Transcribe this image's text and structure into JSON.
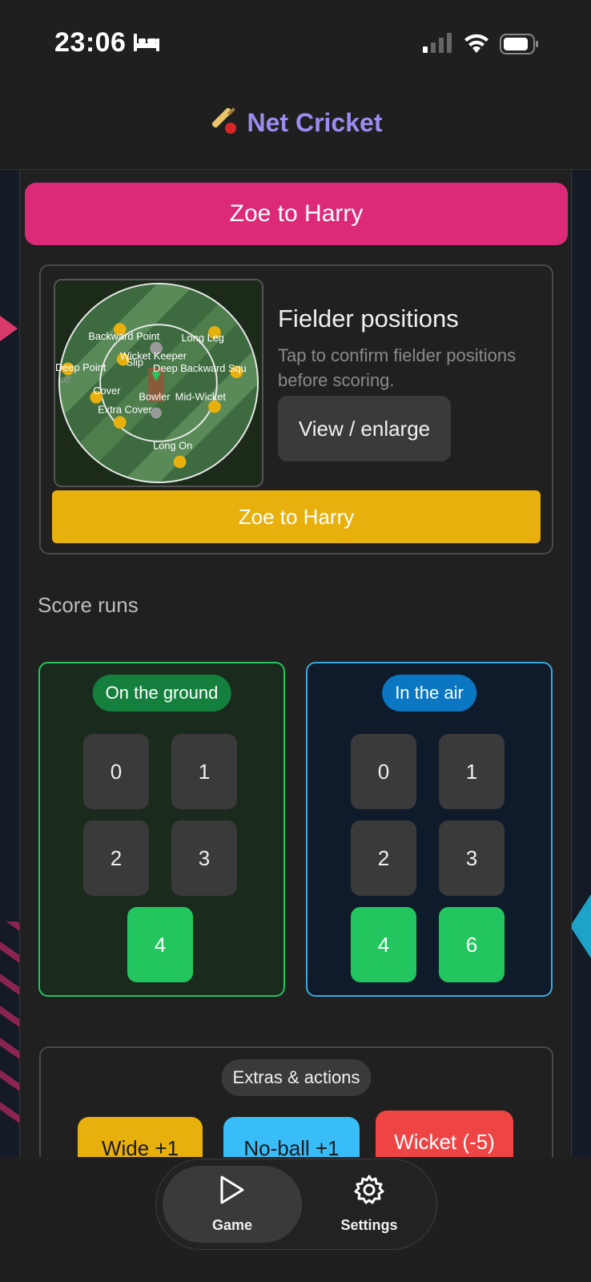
{
  "status": {
    "time": "23:06"
  },
  "header": {
    "title": "Net Cricket"
  },
  "pass_banner": "Zoe to Harry",
  "fielder_card": {
    "title": "Fielder positions",
    "description": "Tap to confirm fielder positions before scoring.",
    "view_button": "View / enlarge",
    "confirm_banner": "Zoe to Harry",
    "field_labels": {
      "backward_point": "Backward Point",
      "long_leg": "Long Leg",
      "wicket_keeper": "Wicket Keeper",
      "slip": "Slip",
      "deep_point": "Deep Point",
      "deep_backward_square": "Deep Backward Squ",
      "off": "off",
      "cover": "Cover",
      "bowler": "Bowler",
      "mid_wicket": "Mid-Wicket",
      "extra_cover": "Extra Cover",
      "long_on": "Long On"
    }
  },
  "score": {
    "heading": "Score runs",
    "ground": {
      "label": "On the ground",
      "runs": [
        "0",
        "1",
        "2",
        "3",
        "4"
      ]
    },
    "air": {
      "label": "In the air",
      "runs": [
        "0",
        "1",
        "2",
        "3",
        "4",
        "6"
      ]
    }
  },
  "extras": {
    "label": "Extras & actions",
    "wide": "Wide +1",
    "no_ball": "No-ball +1",
    "wicket": "Wicket (-5)"
  },
  "nav": {
    "game": "Game",
    "settings": "Settings"
  },
  "colors": {
    "accent_purple": "#9b8cf0",
    "pink": "#dc2a79",
    "yellow": "#e7b00c",
    "green": "#22c55e",
    "blue": "#38bdf8",
    "red": "#ef4444"
  }
}
